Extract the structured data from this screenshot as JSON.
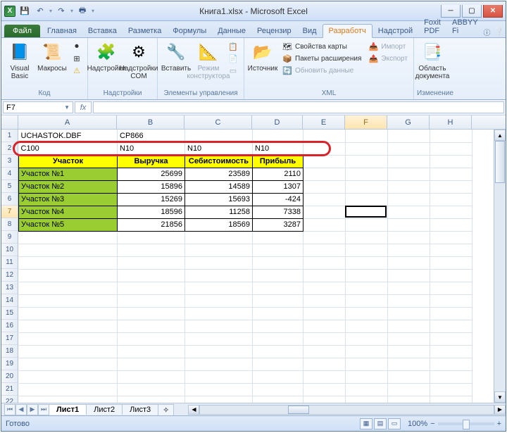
{
  "window": {
    "title": "Книга1.xlsx - Microsoft Excel"
  },
  "tabs": {
    "file": "Файл",
    "items": [
      "Главная",
      "Вставка",
      "Разметка",
      "Формулы",
      "Данные",
      "Рецензир",
      "Вид",
      "Разработч",
      "Надстрой",
      "Foxit PDF",
      "ABBYY Fi"
    ],
    "active_index": 7
  },
  "ribbon": {
    "groups": {
      "code": {
        "label": "Код",
        "visual_basic": "Visual\nBasic",
        "macros": "Макросы",
        "record": "",
        "refs": "",
        "security": ""
      },
      "addins": {
        "label": "Надстройки",
        "addins": "Надстройки",
        "com": "Надстройки\nCOM"
      },
      "controls": {
        "label": "Элементы управления",
        "insert": "Вставить",
        "design": "Режим\nконструктора",
        "props": "",
        "view_code": "",
        "run_dialog": ""
      },
      "xml": {
        "label": "XML",
        "source": "Источник",
        "map_props": "Свойства карты",
        "expand": "Пакеты расширения",
        "refresh": "Обновить данные",
        "import": "Импорт",
        "export": "Экспорт"
      },
      "change": {
        "label": "Изменение",
        "doc_area": "Область\nдокумента"
      }
    }
  },
  "namebox": "F7",
  "formula": "",
  "columns": [
    "A",
    "B",
    "C",
    "D",
    "E",
    "F",
    "G",
    "H"
  ],
  "active_col": "F",
  "row_count": 22,
  "active_row": 7,
  "sheet": {
    "row1": {
      "A": "UCHASTOK.DBF",
      "B": "CP866"
    },
    "row2": {
      "A": "C100",
      "B": "N10",
      "C": "N10",
      "D": "N10"
    },
    "headers": {
      "A": "Участок",
      "B": "Выручка",
      "C": "Себистоимость",
      "D": "Прибыль"
    },
    "rows": [
      {
        "A": "Участок №1",
        "B": 25699,
        "C": 23589,
        "D": 2110
      },
      {
        "A": "Участок №2",
        "B": 15896,
        "C": 14589,
        "D": 1307
      },
      {
        "A": "Участок №3",
        "B": 15269,
        "C": 15693,
        "D": -424
      },
      {
        "A": "Участок №4",
        "B": 18596,
        "C": 11258,
        "D": 7338
      },
      {
        "A": "Участок №5",
        "B": 21856,
        "C": 18569,
        "D": 3287
      }
    ]
  },
  "sheet_tabs": {
    "items": [
      "Лист1",
      "Лист2",
      "Лист3"
    ],
    "active": 0
  },
  "status": {
    "ready": "Готово",
    "zoom": "100%"
  }
}
